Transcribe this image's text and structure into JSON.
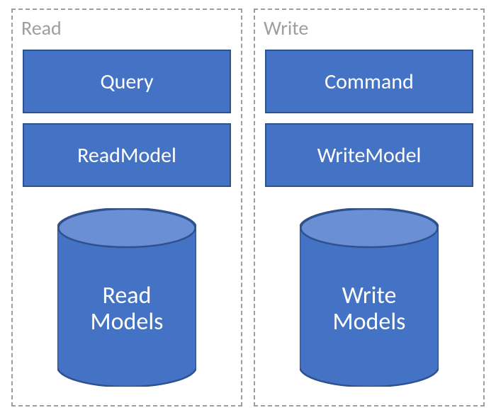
{
  "left": {
    "title": "Read",
    "block1": "Query",
    "block2": "ReadModel",
    "db_line1": "Read",
    "db_line2": "Models"
  },
  "right": {
    "title": "Write",
    "block1": "Command",
    "block2": "WriteModel",
    "db_line1": "Write",
    "db_line2": "Models"
  },
  "colors": {
    "fill": "#4472c4",
    "stroke": "#2f528f",
    "top": "#6a8fd4",
    "dash": "#9e9e9e"
  }
}
